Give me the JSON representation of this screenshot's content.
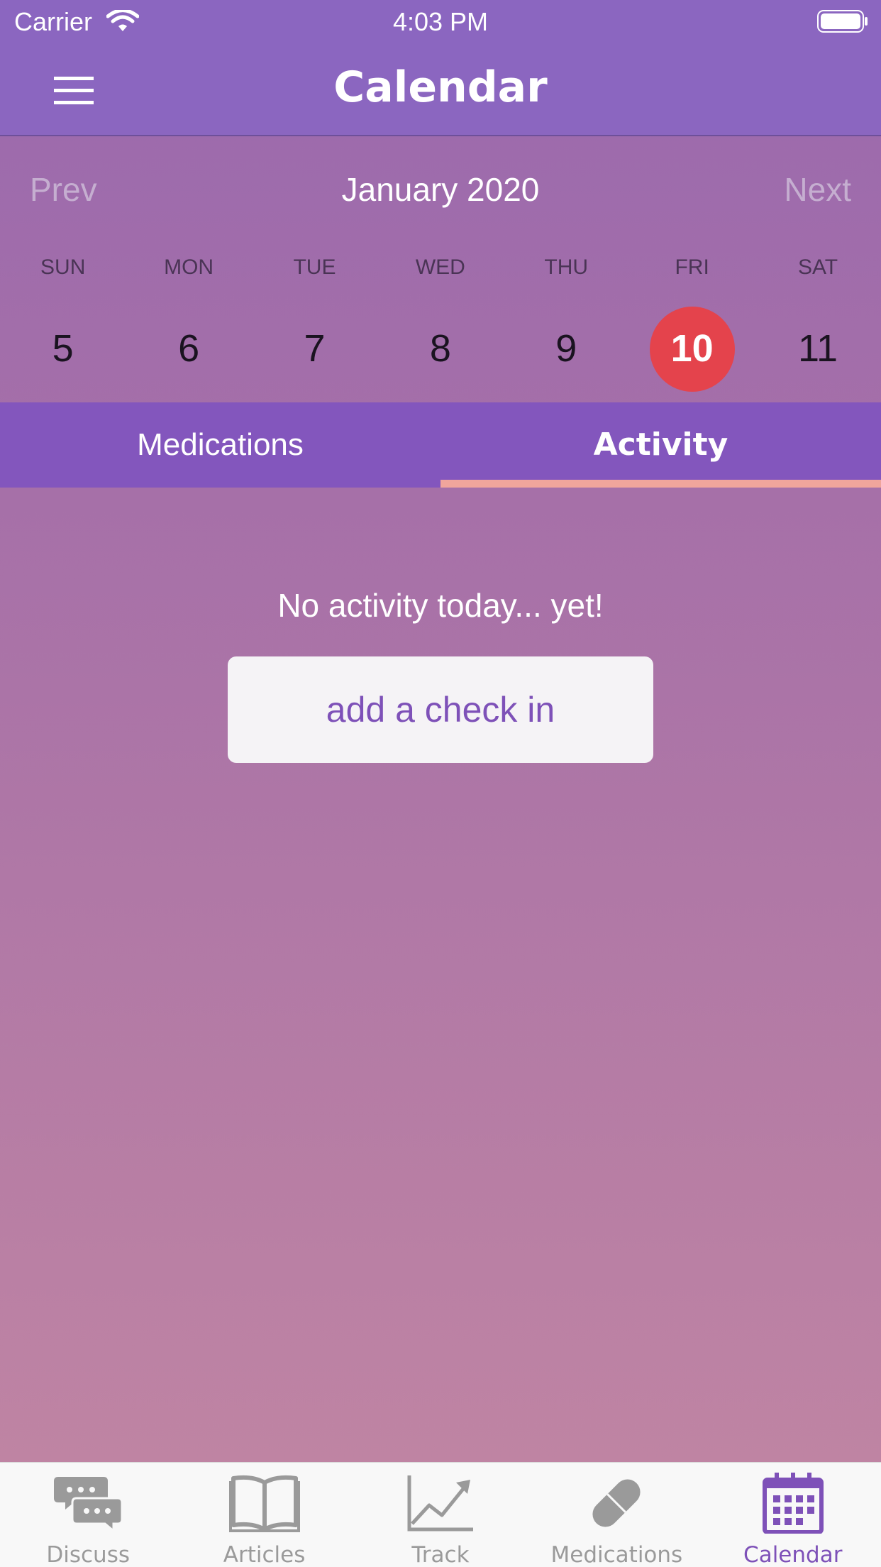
{
  "status_bar": {
    "carrier": "Carrier",
    "time": "4:03 PM"
  },
  "header": {
    "title": "Calendar"
  },
  "calendar": {
    "prev_label": "Prev",
    "next_label": "Next",
    "month_label": "January 2020",
    "weekdays": [
      "SUN",
      "MON",
      "TUE",
      "WED",
      "THU",
      "FRI",
      "SAT"
    ],
    "dates": [
      "5",
      "6",
      "7",
      "8",
      "9",
      "10",
      "11"
    ],
    "selected_date": "10"
  },
  "tabs": [
    {
      "label": "Medications",
      "active": false
    },
    {
      "label": "Activity",
      "active": true
    }
  ],
  "content": {
    "empty_message": "No activity today... yet!",
    "add_button_label": "add a check in"
  },
  "tab_bar": [
    {
      "label": "Discuss",
      "icon": "chat-bubbles-icon",
      "active": false
    },
    {
      "label": "Articles",
      "icon": "open-book-icon",
      "active": false
    },
    {
      "label": "Track",
      "icon": "line-chart-icon",
      "active": false
    },
    {
      "label": "Medications",
      "icon": "pill-icon",
      "active": false
    },
    {
      "label": "Calendar",
      "icon": "calendar-icon",
      "active": true
    }
  ],
  "colors": {
    "header": "#8b66c0",
    "selected_date": "#e4434c",
    "tab_strip": "#8356bd",
    "tab_underline": "#f0a59c",
    "accent": "#7e51b8"
  }
}
